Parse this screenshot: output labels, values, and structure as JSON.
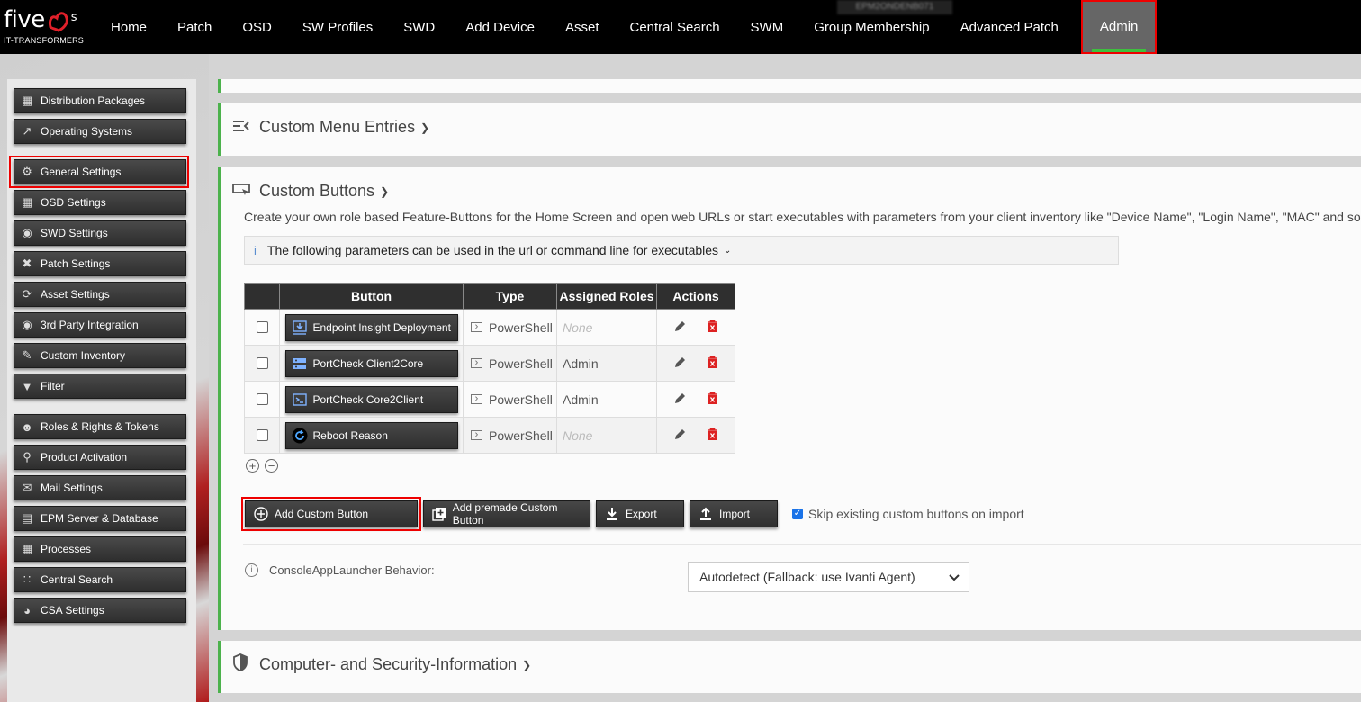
{
  "header": {
    "logo_text": "five",
    "logo_suffix": "s",
    "logo_sub": "IT-TRANSFORMERS",
    "server_name": "EPM2ONDENB071",
    "nav": [
      "Home",
      "Patch",
      "OSD",
      "SW Profiles",
      "SWD",
      "Add Device",
      "Asset",
      "Central Search",
      "SWM",
      "Group Membership",
      "Advanced Patch"
    ],
    "nav_active": "Admin"
  },
  "sidebar": {
    "items": [
      {
        "label": "Distribution Packages",
        "icon": "package-icon"
      },
      {
        "label": "Operating Systems",
        "icon": "external-link-icon"
      },
      {
        "label": "General Settings",
        "icon": "gear-icon"
      },
      {
        "label": "OSD Settings",
        "icon": "windows-icon"
      },
      {
        "label": "SWD Settings",
        "icon": "software-icon"
      },
      {
        "label": "Patch Settings",
        "icon": "bandage-icon"
      },
      {
        "label": "Asset Settings",
        "icon": "refresh-icon"
      },
      {
        "label": "3rd Party Integration",
        "icon": "third-party-icon"
      },
      {
        "label": "Custom Inventory",
        "icon": "pencil-icon"
      },
      {
        "label": "Filter",
        "icon": "filter-icon"
      },
      {
        "label": "Roles & Rights & Tokens",
        "icon": "user-key-icon"
      },
      {
        "label": "Product Activation",
        "icon": "key-icon"
      },
      {
        "label": "Mail Settings",
        "icon": "mail-icon"
      },
      {
        "label": "EPM Server & Database",
        "icon": "server-icon"
      },
      {
        "label": "Processes",
        "icon": "process-icon"
      },
      {
        "label": "Central Search",
        "icon": "grid-icon"
      },
      {
        "label": "CSA Settings",
        "icon": "globe-icon"
      }
    ]
  },
  "sections": {
    "custom_menu": "Custom Menu Entries",
    "custom_buttons": "Custom Buttons",
    "computer_security": "Computer- and Security-Information"
  },
  "custom_buttons": {
    "description": "Create your own role based Feature-Buttons for the Home Screen and open web URLs or start executables with parameters from your client inventory like \"Device Name\", \"Login Name\", \"MAC\" and so on.",
    "info_text": "The following parameters can be used in the url or command line for executables",
    "columns": {
      "button": "Button",
      "type": "Type",
      "roles": "Assigned Roles",
      "actions": "Actions"
    },
    "rows": [
      {
        "button": "Endpoint Insight Deployment",
        "type": "PowerShell",
        "roles": "None",
        "roles_none": true
      },
      {
        "button": "PortCheck Client2Core",
        "type": "PowerShell",
        "roles": "Admin",
        "roles_none": false
      },
      {
        "button": "PortCheck Core2Client",
        "type": "PowerShell",
        "roles": "Admin",
        "roles_none": false
      },
      {
        "button": "Reboot Reason",
        "type": "PowerShell",
        "roles": "None",
        "roles_none": true
      }
    ],
    "add_button": "Add Custom Button",
    "add_premade_button": "Add premade Custom Button",
    "export_button": "Export",
    "import_button": "Import",
    "skip_label": "Skip existing custom buttons on import",
    "skip_checked": true,
    "launcher_label": "ConsoleAppLauncher Behavior:",
    "launcher_value": "Autodetect (Fallback: use Ivanti Agent)"
  }
}
